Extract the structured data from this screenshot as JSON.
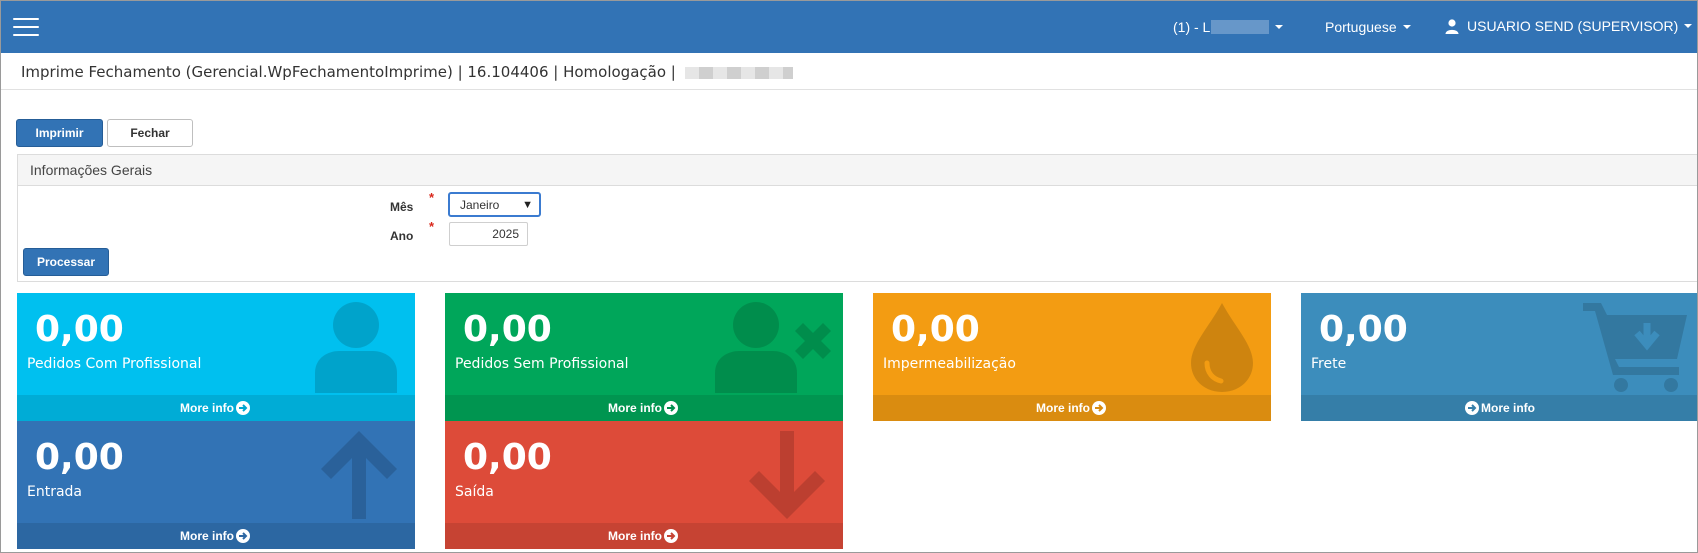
{
  "navbar": {
    "company": "(1) - L",
    "language": "Portuguese",
    "user": "USUARIO SEND (SUPERVISOR)"
  },
  "page": {
    "title": "Imprime Fechamento (Gerencial.WpFechamentoImprime) | 16.104406 | Homologação | "
  },
  "toolbar": {
    "print_label": "Imprimir",
    "close_label": "Fechar"
  },
  "panel": {
    "title": "Informações Gerais",
    "month_label": "Mês",
    "month_value": "Janeiro",
    "year_label": "Ano",
    "year_value": "2025",
    "required_mark": "*",
    "process_label": "Processar"
  },
  "boxes": [
    {
      "value": "0,00",
      "label": "Pedidos Com Profissional",
      "footer": "More info",
      "color": "#00c0ef",
      "icon": "user-icon"
    },
    {
      "value": "0,00",
      "label": "Pedidos Sem Profissional",
      "footer": "More info",
      "color": "#00a65a",
      "icon": "user-times-icon"
    },
    {
      "value": "0,00",
      "label": "Impermeabilização",
      "footer": "More info",
      "color": "#f39c12",
      "icon": "tint-icon"
    },
    {
      "value": "0,00",
      "label": "Frete",
      "footer": "More info",
      "color": "#3c8dbc",
      "icon": "cart-arrow-down-icon"
    },
    {
      "value": "0,00",
      "label": "Entrada",
      "footer": "More info",
      "color": "#3273b5",
      "icon": "arrow-up-icon"
    },
    {
      "value": "0,00",
      "label": "Saída",
      "footer": "More info",
      "color": "#dd4b39",
      "icon": "arrow-down-icon"
    }
  ]
}
